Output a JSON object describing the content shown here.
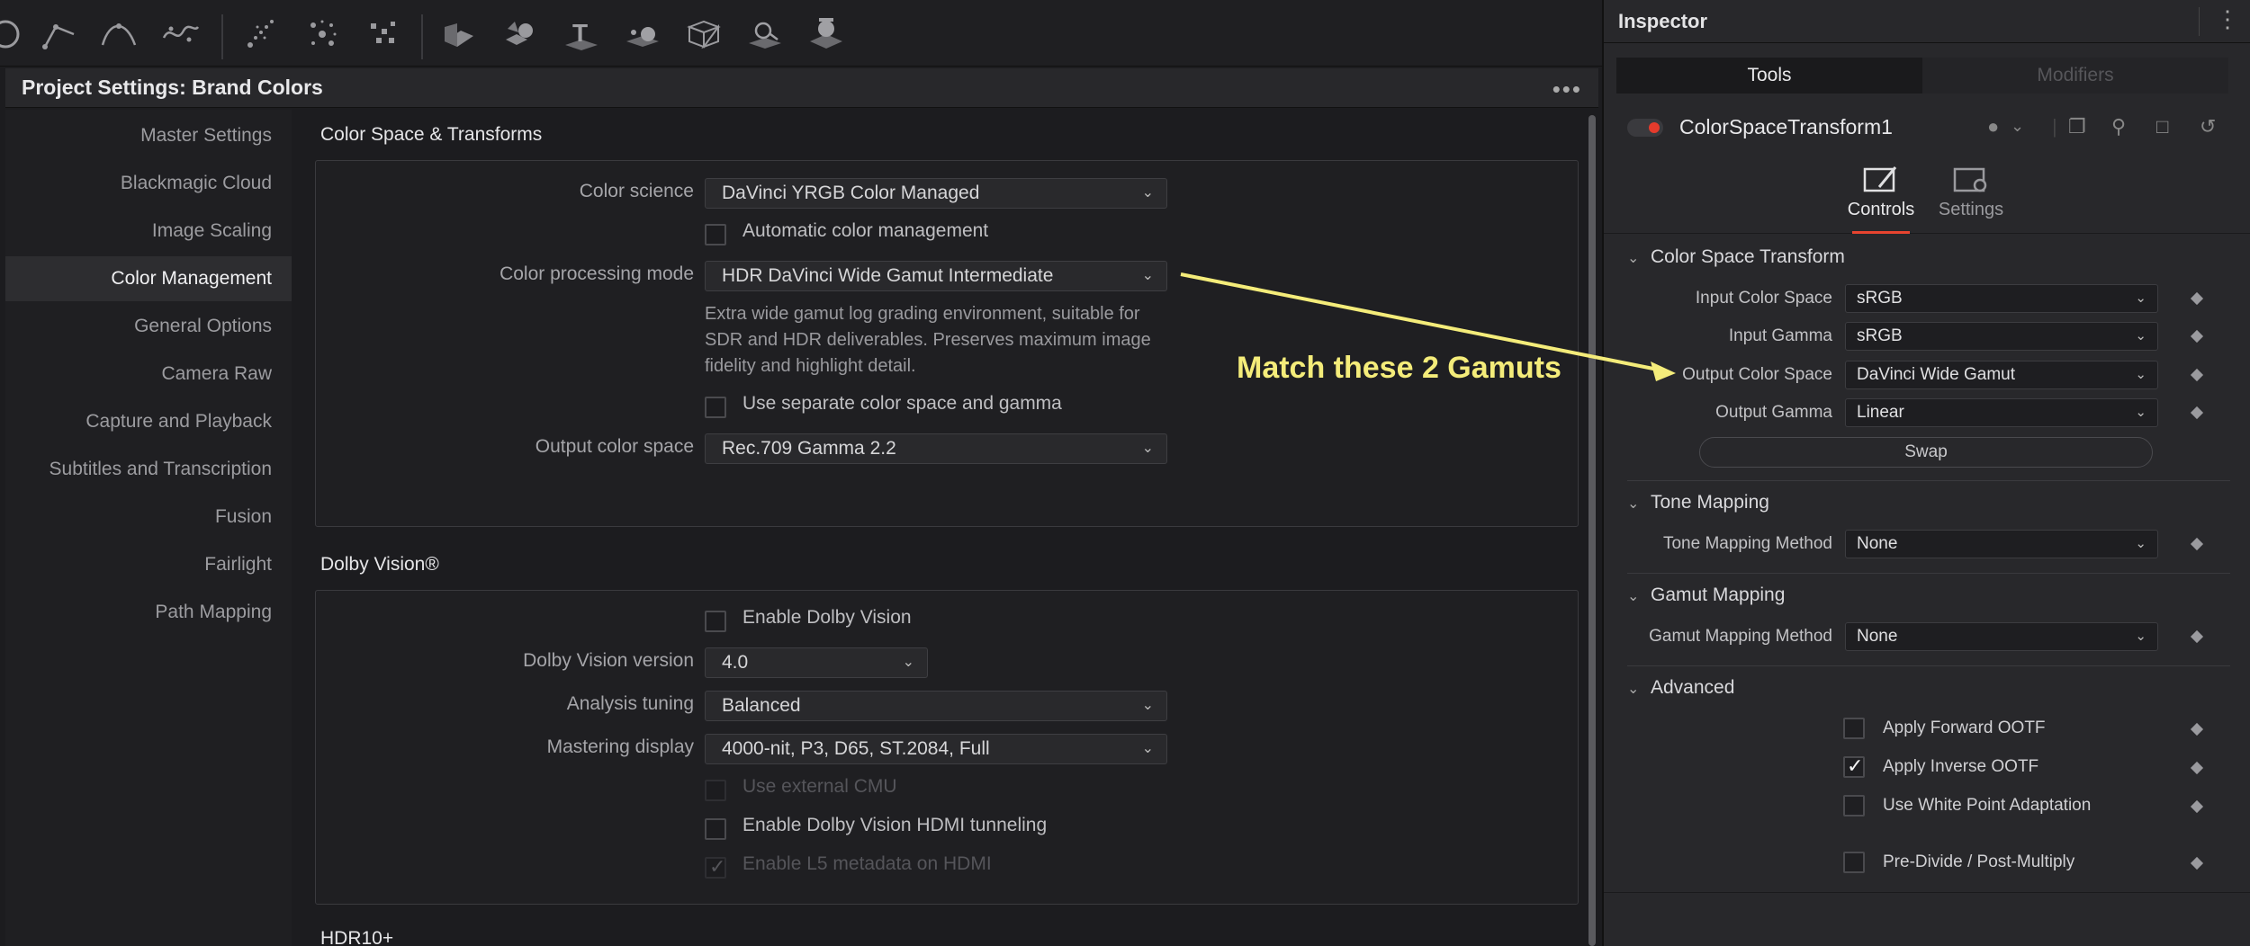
{
  "toolbar": {
    "icons": [
      "polyline-icon",
      "bspline-icon",
      "bezier-icon",
      "wand-icon",
      "particle-emitter-icon",
      "particle-render-icon",
      "particle-kill-icon",
      "shape-3d-icon",
      "merge-3d-icon",
      "text-3d-icon",
      "camera-3d-icon",
      "fbx-icon",
      "light-icon",
      "renderer-3d-icon"
    ]
  },
  "project_settings": {
    "title": "Project Settings:  Brand Colors",
    "more": "•••",
    "sidebar": [
      {
        "label": "Master Settings",
        "active": false
      },
      {
        "label": "Blackmagic Cloud",
        "active": false
      },
      {
        "label": "Image Scaling",
        "active": false
      },
      {
        "label": "Color Management",
        "active": true
      },
      {
        "label": "General Options",
        "active": false
      },
      {
        "label": "Camera Raw",
        "active": false
      },
      {
        "label": "Capture and Playback",
        "active": false
      },
      {
        "label": "Subtitles and Transcription",
        "active": false
      },
      {
        "label": "Fusion",
        "active": false
      },
      {
        "label": "Fairlight",
        "active": false
      },
      {
        "label": "Path Mapping",
        "active": false
      }
    ],
    "color_space": {
      "section_title": "Color Space & Transforms",
      "color_science_label": "Color science",
      "color_science_value": "DaVinci YRGB Color Managed",
      "auto_cm_label": "Automatic color management",
      "processing_mode_label": "Color processing mode",
      "processing_mode_value": "HDR DaVinci Wide Gamut Intermediate",
      "description": "Extra wide gamut log grading environment, suitable for SDR and HDR deliverables. Preserves maximum image fidelity and highlight detail.",
      "separate_label": "Use separate color space and gamma",
      "output_cs_label": "Output color space",
      "output_cs_value": "Rec.709 Gamma 2.2"
    },
    "dolby": {
      "section_title": "Dolby Vision®",
      "enable_label": "Enable Dolby Vision",
      "version_label": "Dolby Vision version",
      "version_value": "4.0",
      "tuning_label": "Analysis tuning",
      "tuning_value": "Balanced",
      "mastering_label": "Mastering display",
      "mastering_value": "4000-nit, P3, D65, ST.2084, Full",
      "external_cmu_label": "Use external CMU",
      "hdmi_tunnel_label": "Enable Dolby Vision HDMI tunneling",
      "l5_label": "Enable L5 metadata on HDMI"
    },
    "hdr10_title": "HDR10+"
  },
  "inspector": {
    "title": "Inspector",
    "more": "⋮",
    "tabs": {
      "tools": "Tools",
      "modifiers": "Modifiers"
    },
    "tool_name": "ColorSpaceTransform1",
    "ctrl_tabs": {
      "controls": "Controls",
      "settings": "Settings"
    },
    "cst": {
      "title": "Color Space Transform",
      "input_cs_label": "Input Color Space",
      "input_cs_value": "sRGB",
      "input_gamma_label": "Input Gamma",
      "input_gamma_value": "sRGB",
      "output_cs_label": "Output Color Space",
      "output_cs_value": "DaVinci Wide Gamut",
      "output_gamma_label": "Output Gamma",
      "output_gamma_value": "Linear",
      "swap_label": "Swap"
    },
    "tone": {
      "title": "Tone Mapping",
      "method_label": "Tone Mapping Method",
      "method_value": "None"
    },
    "gamut": {
      "title": "Gamut Mapping",
      "method_label": "Gamut Mapping Method",
      "method_value": "None"
    },
    "advanced": {
      "title": "Advanced",
      "forward_label": "Apply Forward OOTF",
      "inverse_label": "Apply Inverse OOTF",
      "white_point_label": "Use White Point Adaptation",
      "predivide_label": "Pre-Divide / Post-Multiply"
    }
  },
  "annotation": {
    "text": "Match these 2 Gamuts",
    "color": "#f4ec7a"
  },
  "colors": {
    "accent_red": "#e53b2c",
    "bg": "#1c1c1f"
  }
}
